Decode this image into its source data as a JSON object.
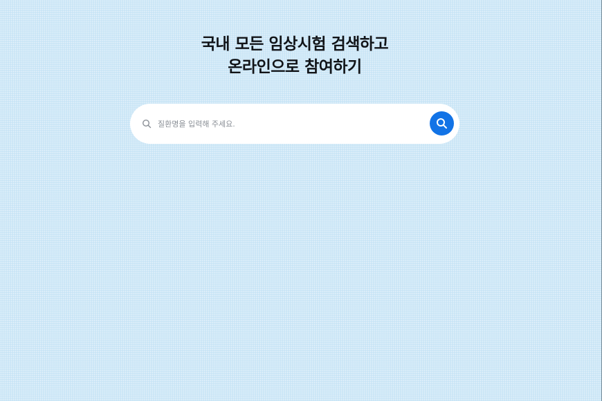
{
  "hero": {
    "title_line1": "국내 모든 임상시험 검색하고",
    "title_line2": "온라인으로 참여하기"
  },
  "search": {
    "placeholder": "질환명을 입력해 주세요.",
    "value": "",
    "lead_icon": "search-icon",
    "button_icon": "search-icon"
  },
  "colors": {
    "background": "#c9e5f6",
    "accent": "#1273e6",
    "title_text": "#111418"
  }
}
